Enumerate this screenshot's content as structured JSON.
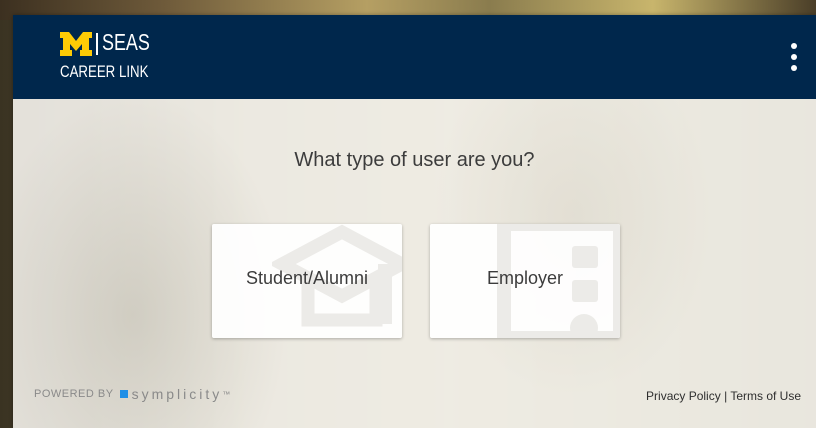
{
  "header": {
    "logo_letter": "M",
    "logo_title": "SEAS",
    "logo_subtitle": "CAREER LINK",
    "menu_icon": "more-vertical-icon"
  },
  "main": {
    "question": "What type of user are you?",
    "choices": [
      {
        "label": "Student/Alumni",
        "icon": "graduation-cap-icon"
      },
      {
        "label": "Employer",
        "icon": "building-icon"
      }
    ]
  },
  "footer": {
    "powered_by": "POWERED BY",
    "brand": "symplicity",
    "brand_mark": "™",
    "privacy_label": "Privacy Policy",
    "separator": "|",
    "terms_label": "Terms of Use"
  },
  "colors": {
    "header_bg": "#00274c",
    "maize": "#ffcb05",
    "symplicity_blue": "#1f8fe6"
  }
}
